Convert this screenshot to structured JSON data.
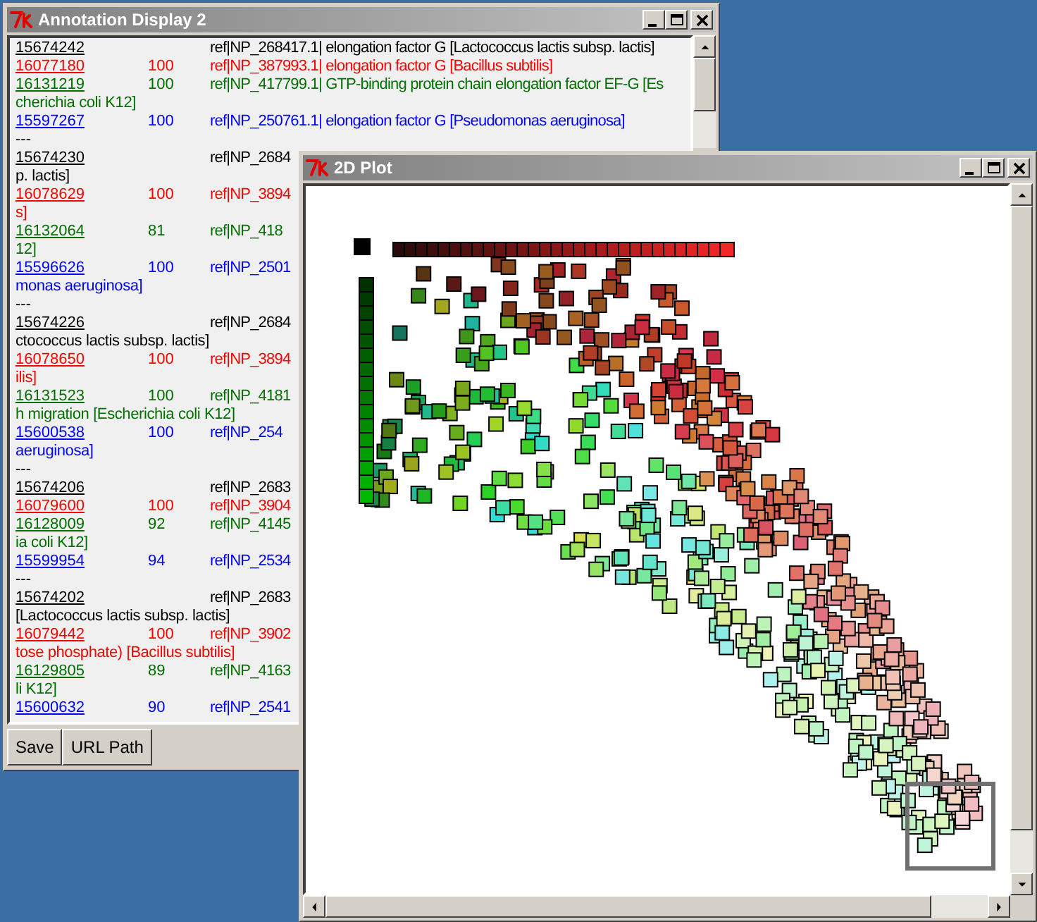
{
  "annotation_window": {
    "title": "Annotation Display 2",
    "records": [
      {
        "kind": "hit",
        "id": "15674242",
        "ref": "ref|NP_268417.1| elongation factor G [Lactococcus lactis subsp. lactis]",
        "color": "#000000"
      },
      {
        "kind": "hit",
        "id": "16077180",
        "score": "100",
        "ref": "ref|NP_387993.1| elongation factor G [Bacillus subtilis]",
        "color": "#ff0000"
      },
      {
        "kind": "hit",
        "id": "16131219",
        "score": "100",
        "ref": "ref|NP_417799.1| GTP-binding protein chain elongation factor EF-G [Es",
        "continuation": "cherichia coli K12]",
        "color": "#007000"
      },
      {
        "kind": "hit",
        "id": "15597267",
        "score": "100",
        "ref": "ref|NP_250761.1| elongation factor G [Pseudomonas aeruginosa]",
        "color": "#0000ff"
      },
      {
        "kind": "separator",
        "text": "---"
      },
      {
        "kind": "hit",
        "id": "15674230",
        "ref": "ref|NP_2684",
        "continuation": "p. lactis]",
        "color": "#000000"
      },
      {
        "kind": "hit",
        "id": "16078629",
        "score": "100",
        "ref": "ref|NP_3894",
        "continuation": "s]",
        "color": "#ff0000"
      },
      {
        "kind": "hit",
        "id": "16132064",
        "score": "81",
        "ref": "ref|NP_418",
        "continuation": "12]",
        "color": "#007000"
      },
      {
        "kind": "hit",
        "id": "15596626",
        "score": "100",
        "ref": "ref|NP_2501",
        "continuation": "monas aeruginosa]",
        "color": "#0000ff"
      },
      {
        "kind": "separator",
        "text": "---"
      },
      {
        "kind": "hit",
        "id": "15674226",
        "ref": "ref|NP_2684",
        "continuation": "ctococcus lactis subsp. lactis]",
        "color": "#000000"
      },
      {
        "kind": "hit",
        "id": "16078650",
        "score": "100",
        "ref": "ref|NP_3894",
        "continuation": "ilis]",
        "color": "#ff0000"
      },
      {
        "kind": "hit",
        "id": "16131523",
        "score": "100",
        "ref": "ref|NP_4181",
        "continuation": "h migration [Escherichia coli K12]",
        "color": "#007000"
      },
      {
        "kind": "hit",
        "id": "15600538",
        "score": "100",
        "ref": "ref|NP_254",
        "continuation": "aeruginosa]",
        "color": "#0000ff"
      },
      {
        "kind": "separator",
        "text": "---"
      },
      {
        "kind": "hit",
        "id": "15674206",
        "ref": "ref|NP_2683",
        "color": "#000000"
      },
      {
        "kind": "hit",
        "id": "16079600",
        "score": "100",
        "ref": "ref|NP_3904",
        "color": "#ff0000"
      },
      {
        "kind": "hit",
        "id": "16128009",
        "score": "92",
        "ref": "ref|NP_4145",
        "continuation": "ia coli K12]",
        "color": "#007000"
      },
      {
        "kind": "hit",
        "id": "15599954",
        "score": "94",
        "ref": "ref|NP_2534",
        "color": "#0000ff"
      },
      {
        "kind": "separator",
        "text": "---"
      },
      {
        "kind": "hit",
        "id": "15674202",
        "ref": "ref|NP_2683",
        "continuation": "[Lactococcus lactis subsp. lactis]",
        "color": "#000000"
      },
      {
        "kind": "hit",
        "id": "16079442",
        "score": "100",
        "ref": "ref|NP_3902",
        "continuation": "tose phosphate) [Bacillus subtilis]",
        "color": "#ff0000"
      },
      {
        "kind": "hit",
        "id": "16129805",
        "score": "89",
        "ref": "ref|NP_4163",
        "continuation": "li K12]",
        "color": "#007000"
      },
      {
        "kind": "hit",
        "id": "15600632",
        "score": "90",
        "ref": "ref|NP_2541",
        "color": "#0000ff"
      }
    ],
    "buttons": [
      "Save",
      "URL Path"
    ]
  },
  "plot_window": {
    "title": "2D Plot"
  }
}
